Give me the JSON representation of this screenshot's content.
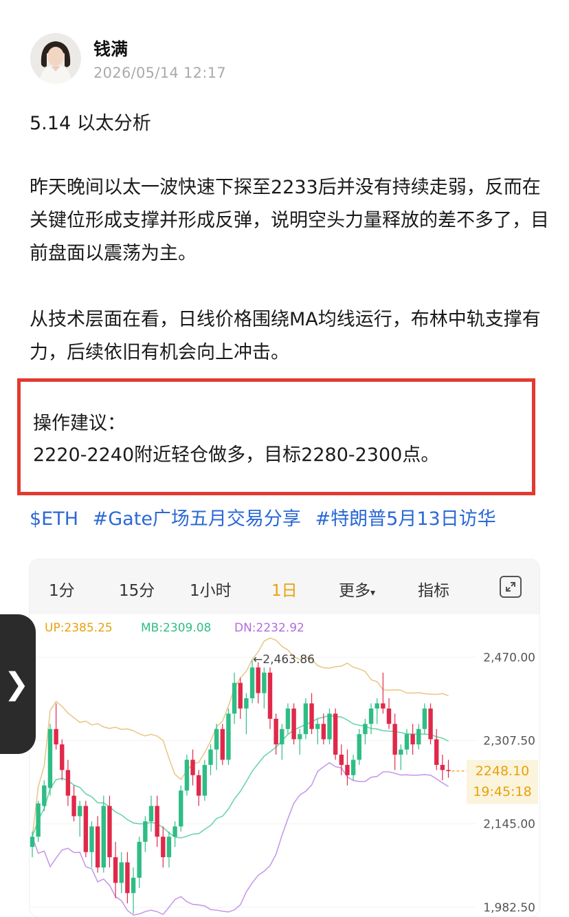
{
  "post": {
    "author": "钱满",
    "timestamp": "2026/05/14 12:17",
    "title": "5.14 以太分析",
    "paragraph1": "昨天晚间以太一波快速下探至2233后并没有持续走弱，反而在关键位形成支撑并形成反弹，说明空头力量释放的差不多了，目前盘面以震荡为主。",
    "paragraph2": "从技术层面在看，日线价格围绕MA均线运行，布林中轨支撑有力，后续依旧有机会向上冲击。",
    "advice_title": "操作建议：",
    "advice_body": "2220-2240附近轻仓做多，目标2280-2300点。",
    "tags": [
      "$ETH",
      "#Gate广场五月交易分享",
      "#特朗普5月13日访华"
    ]
  },
  "chart": {
    "tabs": [
      "1分",
      "15分",
      "1小时",
      "1日",
      "更多",
      "指标"
    ],
    "active_tab": "1日",
    "more_caret": "▾",
    "boll": {
      "up": "UP:2385.25",
      "mb": "MB:2309.08",
      "dn": "DN:2232.92"
    },
    "price_labels": [
      "2,470.00",
      "2,307.50",
      "2,145.00",
      "1,982.50"
    ],
    "high_label": "←2,463.86",
    "current_price": "2248.10",
    "countdown": "19:45:18",
    "colors": {
      "up": "#2ebd85",
      "down": "#e0294a",
      "upper": "#e8c98a",
      "mid": "#6dd3a8",
      "lower": "#c79ae8",
      "accent": "#e8a10a"
    }
  },
  "chart_data": {
    "type": "candlestick",
    "title": "",
    "ylim": [
      1950,
      2500
    ],
    "y_ticks": [
      2470.0,
      2307.5,
      2145.0,
      1982.5
    ],
    "indicators": {
      "BOLL_UP": 2385.25,
      "BOLL_MB": 2309.08,
      "BOLL_DN": 2232.92
    },
    "max_marker": 2463.86,
    "last_price": 2248.1,
    "candles": [
      {
        "o": 2100,
        "h": 2130,
        "l": 2080,
        "c": 2120
      },
      {
        "o": 2120,
        "h": 2190,
        "l": 2110,
        "c": 2185
      },
      {
        "o": 2180,
        "h": 2230,
        "l": 2170,
        "c": 2220
      },
      {
        "o": 2215,
        "h": 2340,
        "l": 2200,
        "c": 2330
      },
      {
        "o": 2330,
        "h": 2380,
        "l": 2290,
        "c": 2300
      },
      {
        "o": 2300,
        "h": 2310,
        "l": 2230,
        "c": 2250
      },
      {
        "o": 2250,
        "h": 2270,
        "l": 2180,
        "c": 2200
      },
      {
        "o": 2200,
        "h": 2220,
        "l": 2150,
        "c": 2160
      },
      {
        "o": 2160,
        "h": 2190,
        "l": 2120,
        "c": 2180
      },
      {
        "o": 2180,
        "h": 2190,
        "l": 2080,
        "c": 2090
      },
      {
        "o": 2090,
        "h": 2150,
        "l": 2060,
        "c": 2140
      },
      {
        "o": 2140,
        "h": 2160,
        "l": 2050,
        "c": 2060
      },
      {
        "o": 2060,
        "h": 2200,
        "l": 2050,
        "c": 2180
      },
      {
        "o": 2180,
        "h": 2200,
        "l": 2060,
        "c": 2080
      },
      {
        "o": 2080,
        "h": 2110,
        "l": 2000,
        "c": 2030
      },
      {
        "o": 2030,
        "h": 2090,
        "l": 2010,
        "c": 2070
      },
      {
        "o": 2070,
        "h": 2090,
        "l": 1990,
        "c": 2010
      },
      {
        "o": 2010,
        "h": 2060,
        "l": 1970,
        "c": 2040
      },
      {
        "o": 2040,
        "h": 2120,
        "l": 2020,
        "c": 2110
      },
      {
        "o": 2110,
        "h": 2160,
        "l": 2090,
        "c": 2150
      },
      {
        "o": 2150,
        "h": 2200,
        "l": 2130,
        "c": 2180
      },
      {
        "o": 2180,
        "h": 2200,
        "l": 2100,
        "c": 2120
      },
      {
        "o": 2120,
        "h": 2140,
        "l": 2060,
        "c": 2080
      },
      {
        "o": 2080,
        "h": 2130,
        "l": 2060,
        "c": 2120
      },
      {
        "o": 2120,
        "h": 2150,
        "l": 2100,
        "c": 2140
      },
      {
        "o": 2140,
        "h": 2220,
        "l": 2130,
        "c": 2210
      },
      {
        "o": 2210,
        "h": 2280,
        "l": 2200,
        "c": 2270
      },
      {
        "o": 2270,
        "h": 2290,
        "l": 2220,
        "c": 2240
      },
      {
        "o": 2240,
        "h": 2250,
        "l": 2180,
        "c": 2200
      },
      {
        "o": 2200,
        "h": 2270,
        "l": 2190,
        "c": 2260
      },
      {
        "o": 2260,
        "h": 2300,
        "l": 2240,
        "c": 2290
      },
      {
        "o": 2290,
        "h": 2340,
        "l": 2250,
        "c": 2330
      },
      {
        "o": 2330,
        "h": 2340,
        "l": 2260,
        "c": 2270
      },
      {
        "o": 2270,
        "h": 2370,
        "l": 2260,
        "c": 2360
      },
      {
        "o": 2360,
        "h": 2440,
        "l": 2340,
        "c": 2420
      },
      {
        "o": 2420,
        "h": 2430,
        "l": 2350,
        "c": 2370
      },
      {
        "o": 2370,
        "h": 2400,
        "l": 2320,
        "c": 2390
      },
      {
        "o": 2390,
        "h": 2464,
        "l": 2380,
        "c": 2450
      },
      {
        "o": 2450,
        "h": 2460,
        "l": 2380,
        "c": 2400
      },
      {
        "o": 2400,
        "h": 2450,
        "l": 2370,
        "c": 2440
      },
      {
        "o": 2440,
        "h": 2450,
        "l": 2330,
        "c": 2350
      },
      {
        "o": 2350,
        "h": 2360,
        "l": 2280,
        "c": 2300
      },
      {
        "o": 2300,
        "h": 2340,
        "l": 2270,
        "c": 2330
      },
      {
        "o": 2330,
        "h": 2380,
        "l": 2320,
        "c": 2370
      },
      {
        "o": 2370,
        "h": 2380,
        "l": 2300,
        "c": 2310
      },
      {
        "o": 2310,
        "h": 2330,
        "l": 2280,
        "c": 2320
      },
      {
        "o": 2320,
        "h": 2390,
        "l": 2310,
        "c": 2380
      },
      {
        "o": 2380,
        "h": 2400,
        "l": 2320,
        "c": 2330
      },
      {
        "o": 2330,
        "h": 2350,
        "l": 2300,
        "c": 2340
      },
      {
        "o": 2340,
        "h": 2360,
        "l": 2300,
        "c": 2310
      },
      {
        "o": 2310,
        "h": 2370,
        "l": 2300,
        "c": 2360
      },
      {
        "o": 2360,
        "h": 2370,
        "l": 2270,
        "c": 2280
      },
      {
        "o": 2280,
        "h": 2300,
        "l": 2240,
        "c": 2260
      },
      {
        "o": 2260,
        "h": 2290,
        "l": 2220,
        "c": 2240
      },
      {
        "o": 2240,
        "h": 2280,
        "l": 2230,
        "c": 2270
      },
      {
        "o": 2270,
        "h": 2330,
        "l": 2260,
        "c": 2320
      },
      {
        "o": 2320,
        "h": 2350,
        "l": 2300,
        "c": 2340
      },
      {
        "o": 2340,
        "h": 2380,
        "l": 2320,
        "c": 2370
      },
      {
        "o": 2370,
        "h": 2390,
        "l": 2340,
        "c": 2380
      },
      {
        "o": 2380,
        "h": 2440,
        "l": 2360,
        "c": 2370
      },
      {
        "o": 2370,
        "h": 2390,
        "l": 2330,
        "c": 2340
      },
      {
        "o": 2340,
        "h": 2360,
        "l": 2250,
        "c": 2280
      },
      {
        "o": 2280,
        "h": 2300,
        "l": 2250,
        "c": 2290
      },
      {
        "o": 2290,
        "h": 2330,
        "l": 2280,
        "c": 2320
      },
      {
        "o": 2320,
        "h": 2340,
        "l": 2280,
        "c": 2300
      },
      {
        "o": 2300,
        "h": 2340,
        "l": 2290,
        "c": 2330
      },
      {
        "o": 2330,
        "h": 2380,
        "l": 2320,
        "c": 2370
      },
      {
        "o": 2370,
        "h": 2380,
        "l": 2300,
        "c": 2310
      },
      {
        "o": 2310,
        "h": 2330,
        "l": 2250,
        "c": 2260
      },
      {
        "o": 2260,
        "h": 2280,
        "l": 2230,
        "c": 2250
      },
      {
        "o": 2250,
        "h": 2270,
        "l": 2235,
        "c": 2248
      }
    ]
  }
}
